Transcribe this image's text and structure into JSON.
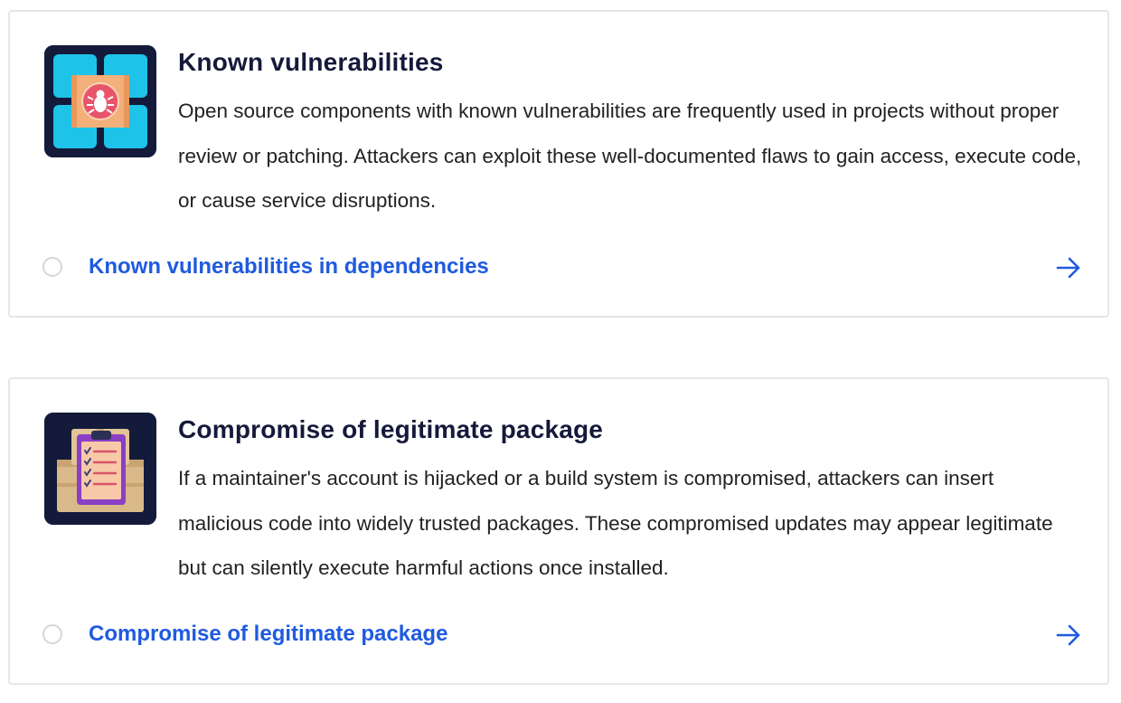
{
  "cards": [
    {
      "title": "Known vulnerabilities",
      "description": "Open source components with known vulnerabilities are frequently used in projects without proper review or patching. Attackers can exploit these well-documented flaws to gain access, execute code, or cause service disruptions.",
      "link_label": "Known vulnerabilities in dependencies",
      "icon": "bug-icon",
      "colors": {
        "tile": "#141a3a",
        "panel": "#1ec3ea",
        "card": "#f3b07a",
        "bug": "#e8546a"
      }
    },
    {
      "title": "Compromise of legitimate package",
      "description": "If a maintainer's account is hijacked or a build system is compromised, attackers can insert malicious code into widely trusted packages. These compromised updates may appear legitimate but can silently execute harmful actions once installed.",
      "link_label": "Compromise of legitimate package",
      "icon": "clipboard-checklist-icon",
      "colors": {
        "tile": "#141a3a",
        "box": "#d9b98a",
        "clipboard": "#8a3fc4",
        "paper": "#f7c9a8"
      }
    }
  ],
  "colors": {
    "link": "#1f5ae0",
    "title": "#15193a",
    "border": "#e4e6ea"
  }
}
